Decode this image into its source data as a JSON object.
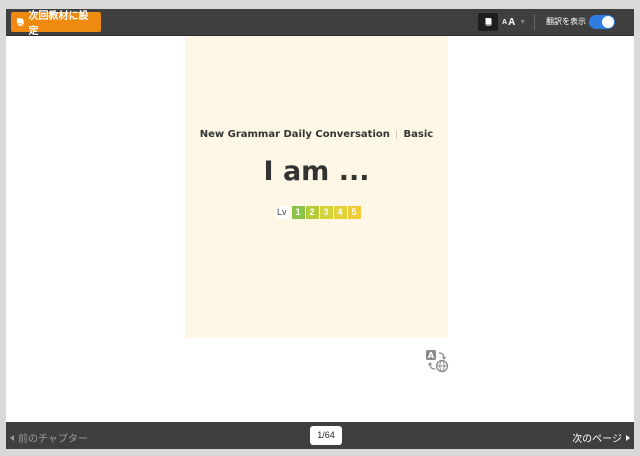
{
  "toolbar": {
    "set_next_material_label": "次回教材に設定",
    "font_size_small": "A",
    "font_size_large": "A",
    "translation_label": "翻訳を表示",
    "translation_on": true
  },
  "page": {
    "subtitle_part1": "New Grammar  Daily Conversation",
    "subtitle_part2": "Basic",
    "title": "I am ...",
    "level_label": "Lv",
    "levels": [
      {
        "label": "1",
        "color": "#8bc34a"
      },
      {
        "label": "2",
        "color": "#b5cc3a"
      },
      {
        "label": "3",
        "color": "#d4d337"
      },
      {
        "label": "4",
        "color": "#e4d23a"
      },
      {
        "label": "5",
        "color": "#f0cc38"
      }
    ]
  },
  "footer": {
    "prev_chapter_label": "前のチャプター",
    "page_indicator": "1/64",
    "next_page_label": "次のページ"
  },
  "colors": {
    "accent_orange": "#ee8a10",
    "toggle_blue": "#2f7de1",
    "page_bg": "#fff7e6",
    "bar_bg": "#3f3f3f"
  },
  "icons": {
    "book": "book-icon",
    "translate": "translate-icon"
  }
}
